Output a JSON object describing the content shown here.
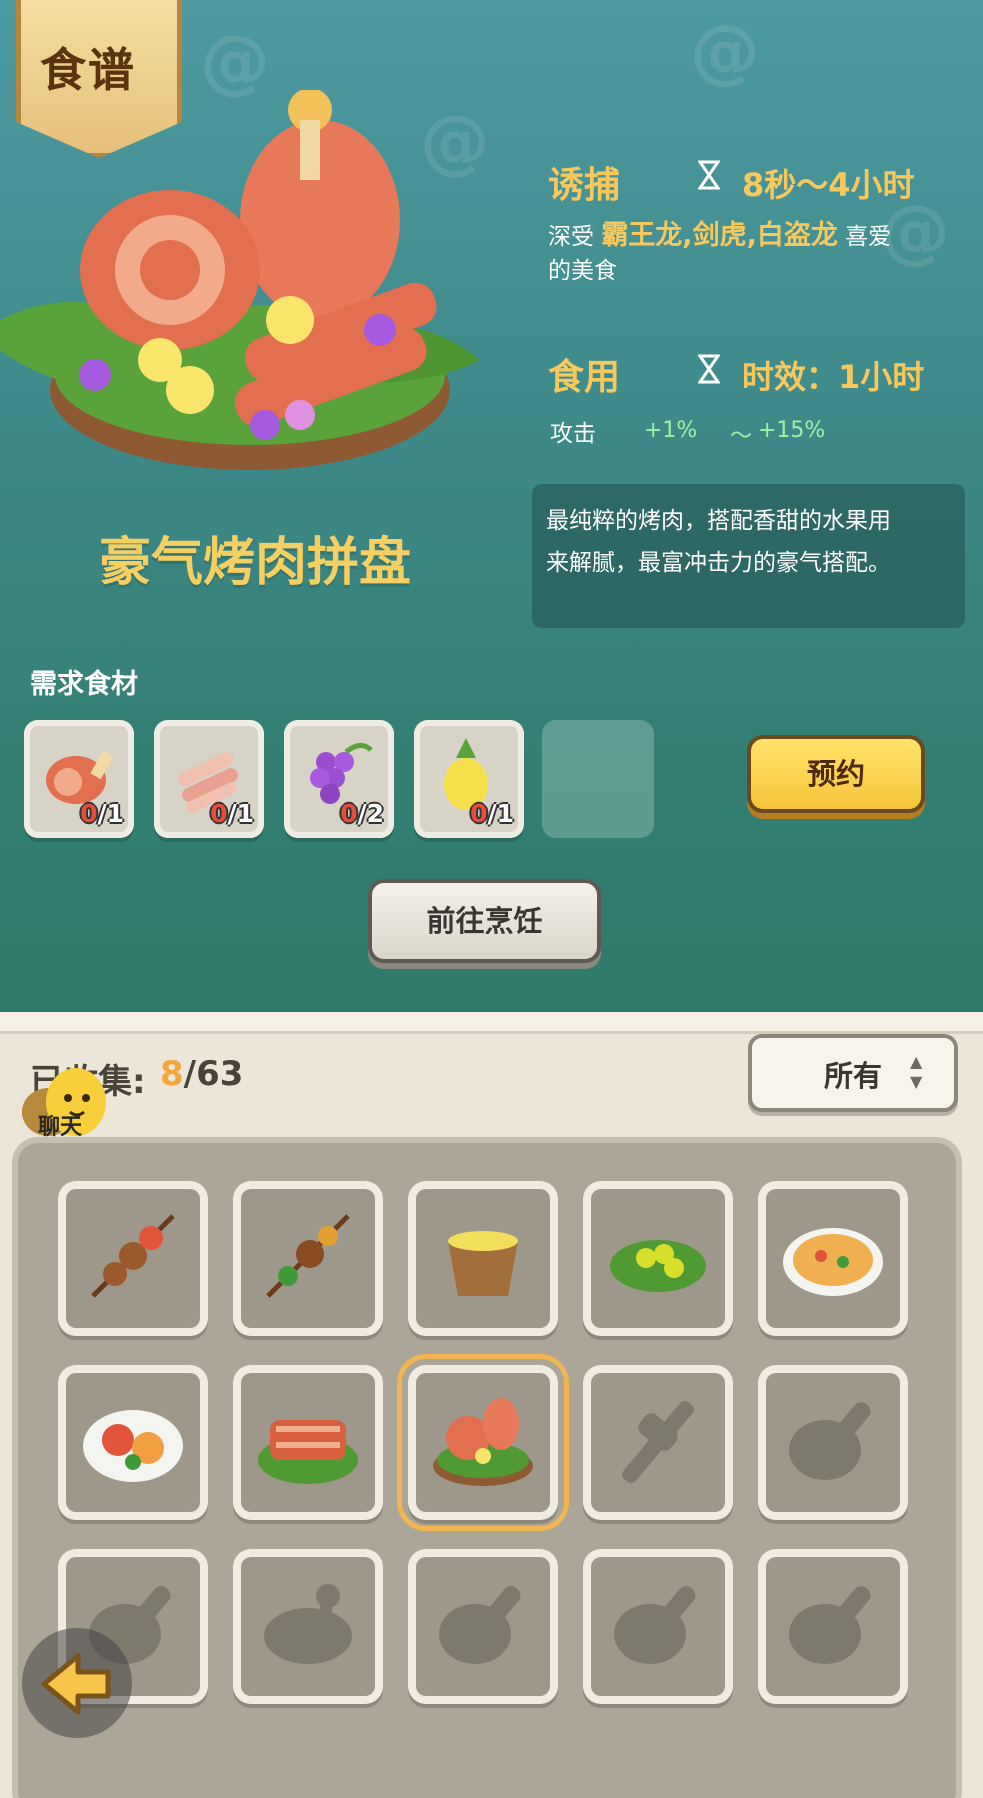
{
  "header": {
    "title": "食谱"
  },
  "recipe": {
    "name": "豪气烤肉拼盘",
    "lure": {
      "label": "诱捕",
      "time": "8秒～4小时",
      "desc_prefix": "深受",
      "creatures": "霸王龙,剑虎,白盗龙",
      "desc_suffix": "喜爱",
      "desc_line2": "的美食"
    },
    "eat": {
      "label": "食用",
      "time": "时效：1小时",
      "stat_label": "攻击",
      "stat_min": "+1%",
      "stat_sep": "～",
      "stat_max": "+15%"
    },
    "description_line1": "最纯粹的烤肉，搭配香甜的水果用",
    "description_line2": "来解腻，最富冲击力的豪气搭配。"
  },
  "ingredients": {
    "title": "需求食材",
    "items": [
      {
        "icon": "meat-icon",
        "have": "0",
        "need": "/1"
      },
      {
        "icon": "ribs-icon",
        "have": "0",
        "need": "/1"
      },
      {
        "icon": "grape-icon",
        "have": "0",
        "need": "/2"
      },
      {
        "icon": "pineapple-icon",
        "have": "0",
        "need": "/1"
      }
    ]
  },
  "buttons": {
    "reserve": "预约",
    "cook": "前往烹饪"
  },
  "collection": {
    "label": "已收集:",
    "got": "8",
    "total": "/63",
    "chat": "聊天",
    "filter": "所有",
    "items": [
      "skewer-icon",
      "mushroom-skewer-icon",
      "pineapple-bowl-icon",
      "fruit-leaf-plate-icon",
      "pizza-plate-icon",
      "fruit-plate-icon",
      "ribs-plate-icon",
      "bbq-platter-icon",
      "locked-skewer-icon",
      "locked-meat-icon",
      "locked-meat-icon",
      "locked-roast-icon",
      "locked-meat-icon",
      "locked-meat-icon",
      "locked-meat-icon"
    ],
    "selected_index": 7
  },
  "colors": {
    "accent": "#f7c95d",
    "bonus": "#9ff0a8",
    "selected": "#f3b54f"
  }
}
